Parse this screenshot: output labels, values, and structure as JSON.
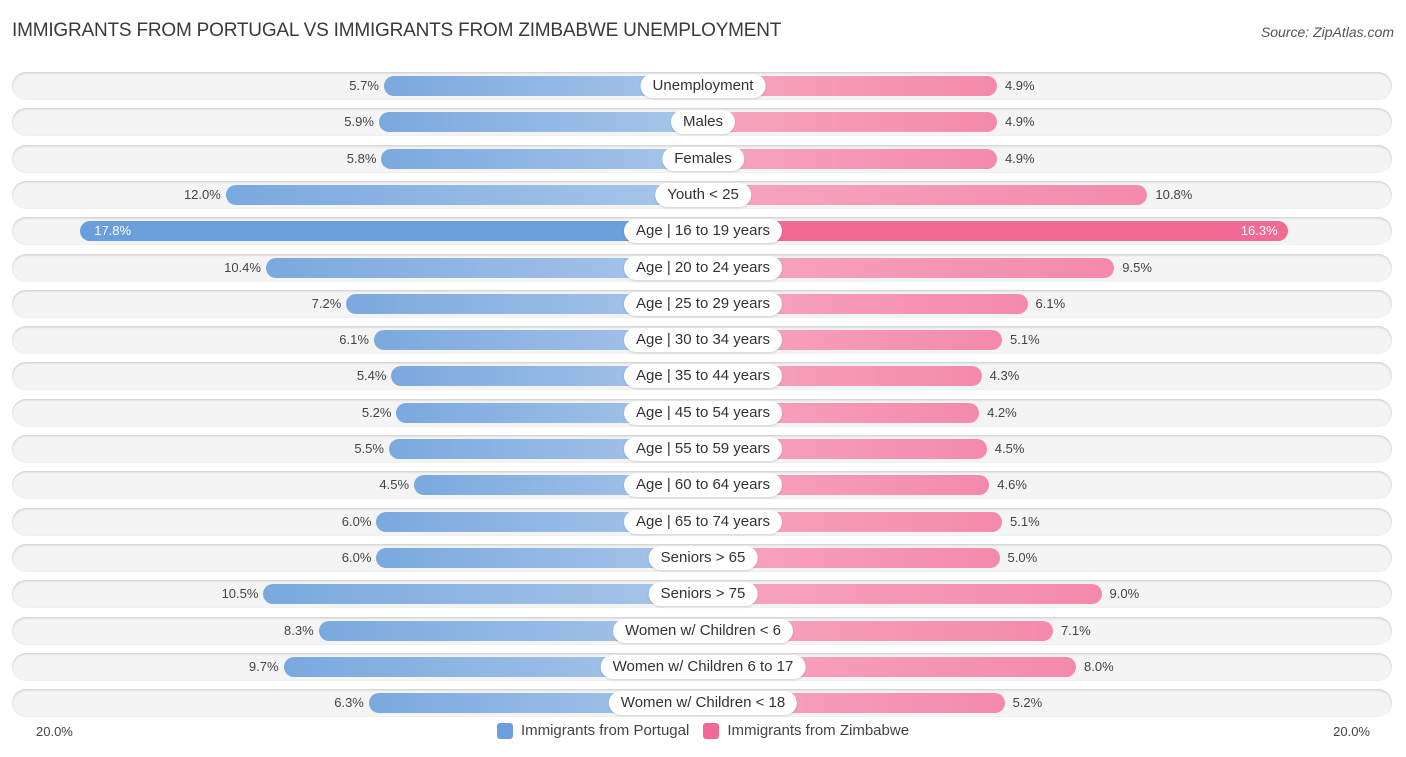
{
  "header": {
    "title": "IMMIGRANTS FROM PORTUGAL VS IMMIGRANTS FROM ZIMBABWE UNEMPLOYMENT",
    "source": "Source: ZipAtlas.com"
  },
  "colors": {
    "portugal": "#6a9fdc",
    "zimbabwe": "#f06a94"
  },
  "chart_data": {
    "type": "bar",
    "orientation": "horizontal-diverging",
    "title": "IMMIGRANTS FROM PORTUGAL VS IMMIGRANTS FROM ZIMBABWE UNEMPLOYMENT",
    "xlabel": "",
    "ylabel": "",
    "axis_min_label": "20.0%",
    "axis_max_label": "20.0%",
    "xlim": [
      0,
      20
    ],
    "legend_position": "bottom",
    "categories": [
      "Unemployment",
      "Males",
      "Females",
      "Youth < 25",
      "Age | 16 to 19 years",
      "Age | 20 to 24 years",
      "Age | 25 to 29 years",
      "Age | 30 to 34 years",
      "Age | 35 to 44 years",
      "Age | 45 to 54 years",
      "Age | 55 to 59 years",
      "Age | 60 to 64 years",
      "Age | 65 to 74 years",
      "Seniors > 65",
      "Seniors > 75",
      "Women w/ Children < 6",
      "Women w/ Children 6 to 17",
      "Women w/ Children < 18"
    ],
    "series": [
      {
        "name": "Immigrants from Portugal",
        "side": "left",
        "values": [
          5.7,
          5.9,
          5.8,
          12.0,
          17.8,
          10.4,
          7.2,
          6.1,
          5.4,
          5.2,
          5.5,
          4.5,
          6.0,
          6.0,
          10.5,
          8.3,
          9.7,
          6.3
        ],
        "labels": [
          "5.7%",
          "5.9%",
          "5.8%",
          "12.0%",
          "17.8%",
          "10.4%",
          "7.2%",
          "6.1%",
          "5.4%",
          "5.2%",
          "5.5%",
          "4.5%",
          "6.0%",
          "6.0%",
          "10.5%",
          "8.3%",
          "9.7%",
          "6.3%"
        ]
      },
      {
        "name": "Immigrants from Zimbabwe",
        "side": "right",
        "values": [
          4.9,
          4.9,
          4.9,
          10.8,
          16.3,
          9.5,
          6.1,
          5.1,
          4.3,
          4.2,
          4.5,
          4.6,
          5.1,
          5.0,
          9.0,
          7.1,
          8.0,
          5.2
        ],
        "labels": [
          "4.9%",
          "4.9%",
          "4.9%",
          "10.8%",
          "16.3%",
          "9.5%",
          "6.1%",
          "5.1%",
          "4.3%",
          "4.2%",
          "4.5%",
          "4.6%",
          "5.1%",
          "5.0%",
          "9.0%",
          "7.1%",
          "8.0%",
          "5.2%"
        ]
      }
    ]
  },
  "legend": {
    "items": [
      {
        "label": "Immigrants from Portugal"
      },
      {
        "label": "Immigrants from Zimbabwe"
      }
    ]
  }
}
